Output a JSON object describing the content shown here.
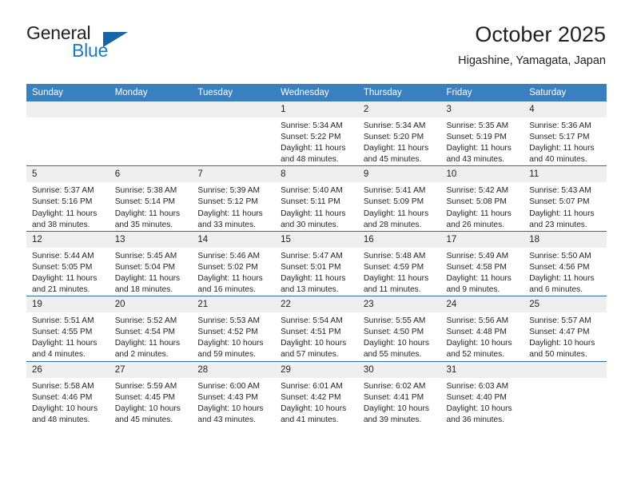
{
  "brand": {
    "name_top": "General",
    "name_bottom": "Blue",
    "accent_color": "#1a7ac4",
    "triangle_color": "#1565a8"
  },
  "header": {
    "title": "October 2025",
    "subtitle": "Higashine, Yamagata, Japan"
  },
  "theme": {
    "header_bg": "#3a7fbf",
    "row_divider": "#2f6ca4",
    "daynum_bg": "#efefef",
    "text": "#231f20"
  },
  "calendar": {
    "weekday_headers": [
      "Sunday",
      "Monday",
      "Tuesday",
      "Wednesday",
      "Thursday",
      "Friday",
      "Saturday"
    ],
    "labels": {
      "sunrise": "Sunrise:",
      "sunset": "Sunset:",
      "daylight": "Daylight:"
    },
    "weeks": [
      [
        {
          "day": "",
          "sunrise": "",
          "sunset": "",
          "daylight_1": "",
          "daylight_2": ""
        },
        {
          "day": "",
          "sunrise": "",
          "sunset": "",
          "daylight_1": "",
          "daylight_2": ""
        },
        {
          "day": "",
          "sunrise": "",
          "sunset": "",
          "daylight_1": "",
          "daylight_2": ""
        },
        {
          "day": "1",
          "sunrise": "Sunrise: 5:34 AM",
          "sunset": "Sunset: 5:22 PM",
          "daylight_1": "Daylight: 11 hours",
          "daylight_2": "and 48 minutes."
        },
        {
          "day": "2",
          "sunrise": "Sunrise: 5:34 AM",
          "sunset": "Sunset: 5:20 PM",
          "daylight_1": "Daylight: 11 hours",
          "daylight_2": "and 45 minutes."
        },
        {
          "day": "3",
          "sunrise": "Sunrise: 5:35 AM",
          "sunset": "Sunset: 5:19 PM",
          "daylight_1": "Daylight: 11 hours",
          "daylight_2": "and 43 minutes."
        },
        {
          "day": "4",
          "sunrise": "Sunrise: 5:36 AM",
          "sunset": "Sunset: 5:17 PM",
          "daylight_1": "Daylight: 11 hours",
          "daylight_2": "and 40 minutes."
        }
      ],
      [
        {
          "day": "5",
          "sunrise": "Sunrise: 5:37 AM",
          "sunset": "Sunset: 5:16 PM",
          "daylight_1": "Daylight: 11 hours",
          "daylight_2": "and 38 minutes."
        },
        {
          "day": "6",
          "sunrise": "Sunrise: 5:38 AM",
          "sunset": "Sunset: 5:14 PM",
          "daylight_1": "Daylight: 11 hours",
          "daylight_2": "and 35 minutes."
        },
        {
          "day": "7",
          "sunrise": "Sunrise: 5:39 AM",
          "sunset": "Sunset: 5:12 PM",
          "daylight_1": "Daylight: 11 hours",
          "daylight_2": "and 33 minutes."
        },
        {
          "day": "8",
          "sunrise": "Sunrise: 5:40 AM",
          "sunset": "Sunset: 5:11 PM",
          "daylight_1": "Daylight: 11 hours",
          "daylight_2": "and 30 minutes."
        },
        {
          "day": "9",
          "sunrise": "Sunrise: 5:41 AM",
          "sunset": "Sunset: 5:09 PM",
          "daylight_1": "Daylight: 11 hours",
          "daylight_2": "and 28 minutes."
        },
        {
          "day": "10",
          "sunrise": "Sunrise: 5:42 AM",
          "sunset": "Sunset: 5:08 PM",
          "daylight_1": "Daylight: 11 hours",
          "daylight_2": "and 26 minutes."
        },
        {
          "day": "11",
          "sunrise": "Sunrise: 5:43 AM",
          "sunset": "Sunset: 5:07 PM",
          "daylight_1": "Daylight: 11 hours",
          "daylight_2": "and 23 minutes."
        }
      ],
      [
        {
          "day": "12",
          "sunrise": "Sunrise: 5:44 AM",
          "sunset": "Sunset: 5:05 PM",
          "daylight_1": "Daylight: 11 hours",
          "daylight_2": "and 21 minutes."
        },
        {
          "day": "13",
          "sunrise": "Sunrise: 5:45 AM",
          "sunset": "Sunset: 5:04 PM",
          "daylight_1": "Daylight: 11 hours",
          "daylight_2": "and 18 minutes."
        },
        {
          "day": "14",
          "sunrise": "Sunrise: 5:46 AM",
          "sunset": "Sunset: 5:02 PM",
          "daylight_1": "Daylight: 11 hours",
          "daylight_2": "and 16 minutes."
        },
        {
          "day": "15",
          "sunrise": "Sunrise: 5:47 AM",
          "sunset": "Sunset: 5:01 PM",
          "daylight_1": "Daylight: 11 hours",
          "daylight_2": "and 13 minutes."
        },
        {
          "day": "16",
          "sunrise": "Sunrise: 5:48 AM",
          "sunset": "Sunset: 4:59 PM",
          "daylight_1": "Daylight: 11 hours",
          "daylight_2": "and 11 minutes."
        },
        {
          "day": "17",
          "sunrise": "Sunrise: 5:49 AM",
          "sunset": "Sunset: 4:58 PM",
          "daylight_1": "Daylight: 11 hours",
          "daylight_2": "and 9 minutes."
        },
        {
          "day": "18",
          "sunrise": "Sunrise: 5:50 AM",
          "sunset": "Sunset: 4:56 PM",
          "daylight_1": "Daylight: 11 hours",
          "daylight_2": "and 6 minutes."
        }
      ],
      [
        {
          "day": "19",
          "sunrise": "Sunrise: 5:51 AM",
          "sunset": "Sunset: 4:55 PM",
          "daylight_1": "Daylight: 11 hours",
          "daylight_2": "and 4 minutes."
        },
        {
          "day": "20",
          "sunrise": "Sunrise: 5:52 AM",
          "sunset": "Sunset: 4:54 PM",
          "daylight_1": "Daylight: 11 hours",
          "daylight_2": "and 2 minutes."
        },
        {
          "day": "21",
          "sunrise": "Sunrise: 5:53 AM",
          "sunset": "Sunset: 4:52 PM",
          "daylight_1": "Daylight: 10 hours",
          "daylight_2": "and 59 minutes."
        },
        {
          "day": "22",
          "sunrise": "Sunrise: 5:54 AM",
          "sunset": "Sunset: 4:51 PM",
          "daylight_1": "Daylight: 10 hours",
          "daylight_2": "and 57 minutes."
        },
        {
          "day": "23",
          "sunrise": "Sunrise: 5:55 AM",
          "sunset": "Sunset: 4:50 PM",
          "daylight_1": "Daylight: 10 hours",
          "daylight_2": "and 55 minutes."
        },
        {
          "day": "24",
          "sunrise": "Sunrise: 5:56 AM",
          "sunset": "Sunset: 4:48 PM",
          "daylight_1": "Daylight: 10 hours",
          "daylight_2": "and 52 minutes."
        },
        {
          "day": "25",
          "sunrise": "Sunrise: 5:57 AM",
          "sunset": "Sunset: 4:47 PM",
          "daylight_1": "Daylight: 10 hours",
          "daylight_2": "and 50 minutes."
        }
      ],
      [
        {
          "day": "26",
          "sunrise": "Sunrise: 5:58 AM",
          "sunset": "Sunset: 4:46 PM",
          "daylight_1": "Daylight: 10 hours",
          "daylight_2": "and 48 minutes."
        },
        {
          "day": "27",
          "sunrise": "Sunrise: 5:59 AM",
          "sunset": "Sunset: 4:45 PM",
          "daylight_1": "Daylight: 10 hours",
          "daylight_2": "and 45 minutes."
        },
        {
          "day": "28",
          "sunrise": "Sunrise: 6:00 AM",
          "sunset": "Sunset: 4:43 PM",
          "daylight_1": "Daylight: 10 hours",
          "daylight_2": "and 43 minutes."
        },
        {
          "day": "29",
          "sunrise": "Sunrise: 6:01 AM",
          "sunset": "Sunset: 4:42 PM",
          "daylight_1": "Daylight: 10 hours",
          "daylight_2": "and 41 minutes."
        },
        {
          "day": "30",
          "sunrise": "Sunrise: 6:02 AM",
          "sunset": "Sunset: 4:41 PM",
          "daylight_1": "Daylight: 10 hours",
          "daylight_2": "and 39 minutes."
        },
        {
          "day": "31",
          "sunrise": "Sunrise: 6:03 AM",
          "sunset": "Sunset: 4:40 PM",
          "daylight_1": "Daylight: 10 hours",
          "daylight_2": "and 36 minutes."
        },
        {
          "day": "",
          "sunrise": "",
          "sunset": "",
          "daylight_1": "",
          "daylight_2": ""
        }
      ]
    ]
  }
}
